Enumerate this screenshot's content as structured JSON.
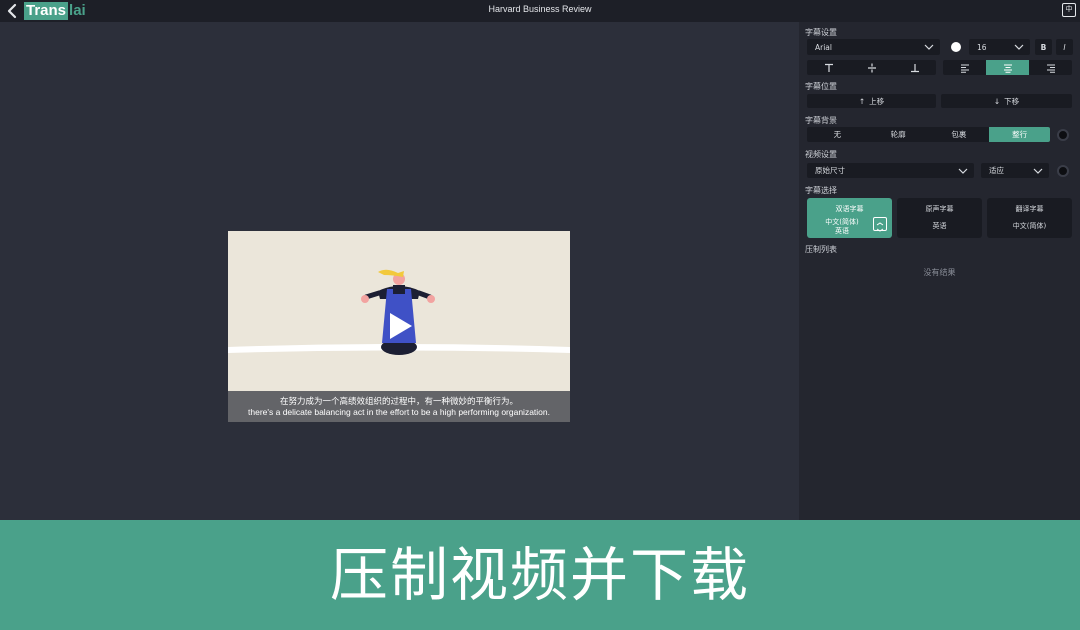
{
  "header": {
    "logo_part1": "Trans",
    "logo_part2": "lai",
    "title": "Harvard Business Review",
    "lang_toggle": "中",
    "back_icon": "chevron-left-icon"
  },
  "video": {
    "subtitle_zh": "在努力成为一个高绩效组织的过程中，有一种微妙的平衡行为。",
    "subtitle_en": "there's a delicate balancing act in the effort to be a high performing organization."
  },
  "panel": {
    "subtitle_settings": {
      "title": "字幕设置",
      "font": "Arial",
      "font_color": "#ffffff",
      "size": "16",
      "bold": "B",
      "italic": "I",
      "vertical_align": [
        "top",
        "middle",
        "bottom"
      ],
      "horizontal_align": [
        "left",
        "center",
        "right"
      ],
      "horizontal_selected": "center"
    },
    "subtitle_position": {
      "title": "字幕位置",
      "up": "上移",
      "down": "下移"
    },
    "subtitle_background": {
      "title": "字幕背景",
      "options": [
        "无",
        "轮廓",
        "包裹",
        "整行"
      ],
      "selected": "整行",
      "color": "#0d0e12"
    },
    "video_settings": {
      "title": "视频设置",
      "size": "原始尺寸",
      "fit": "适应",
      "color": "#0d0e12"
    },
    "subtitle_select": {
      "title": "字幕选择",
      "cards": [
        {
          "title": "双语字幕",
          "line1": "中文(简体)",
          "line2": "英语",
          "active": true
        },
        {
          "title": "原声字幕",
          "line1": "英语",
          "line2": "",
          "active": false
        },
        {
          "title": "翻译字幕",
          "line1": "中文(简体)",
          "line2": "",
          "active": false
        }
      ]
    },
    "burn_list": {
      "title": "压制列表",
      "empty": "没有结果"
    }
  },
  "banner": {
    "text": "压制视频并下载"
  },
  "colors": {
    "accent": "#4aa18a",
    "background": "#2c2f3a",
    "panel": "#24262f",
    "control": "#191b22"
  }
}
